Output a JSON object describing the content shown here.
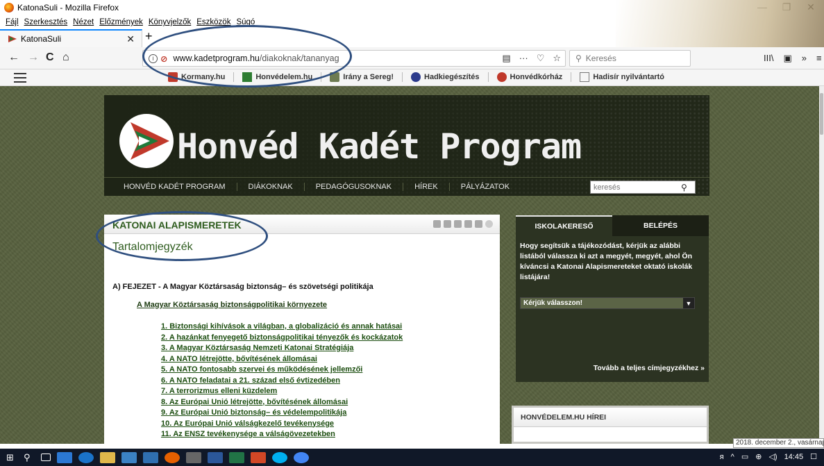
{
  "window": {
    "title": "KatonaSuli - Mozilla Firefox",
    "minimize": "—",
    "maximize": "❐",
    "close": "✕"
  },
  "menu": [
    "Fájl",
    "Szerkesztés",
    "Nézet",
    "Előzmények",
    "Könyvjelzők",
    "Eszközök",
    "Súgó"
  ],
  "tab": {
    "label": "KatonaSuli",
    "close": "✕",
    "new": "+"
  },
  "nav": {
    "back": "←",
    "forward": "→",
    "reload": "C",
    "home": "⌂",
    "url_host": "www.kadetprogram.hu",
    "url_path": "/diakoknak/tananyag",
    "search_placeholder": "Keresés",
    "more": "···",
    "pocket": "♡",
    "star": "☆",
    "library": "III\\",
    "sidebar": "▣",
    "overflow": "»",
    "menu": "≡"
  },
  "govbar": [
    {
      "label": "Kormany.hu",
      "color": "#c0392b"
    },
    {
      "label": "Honvédelem.hu",
      "color": "#2e7d32"
    },
    {
      "label": "Irány a Sereg!",
      "color": "#6d7b52"
    },
    {
      "label": "Hadkiegészítés",
      "color": "#2b3a8c"
    },
    {
      "label": "Honvédkórház",
      "color": "#c0392b"
    },
    {
      "label": "Hadisír nyilvántartó",
      "color": "#777777"
    }
  ],
  "banner": {
    "title": "Honvéd Kadét Program"
  },
  "mainnav": [
    "HONVÉD KADÉT PROGRAM",
    "DIÁKOKNAK",
    "PEDAGÓGUSOKNAK",
    "HÍREK",
    "PÁLYÁZATOK"
  ],
  "site_search_placeholder": "keresés",
  "content": {
    "title": "KATONAI ALAPISMERETEK",
    "toc": "Tartalomjegyzék",
    "chapter": "A) FEJEZET  -  A Magyar Köztársaság biztonság– és szövetségi politikája",
    "section": "A Magyar Köztársaság biztonságpolitikai környezete",
    "items": [
      "1. Biztonsági kihívások a világban, a globalizáció és annak hatásai",
      "2. A hazánkat fenyegető biztonságpolitikai tényezők és kockázatok",
      "3. A Magyar Köztársaság Nemzeti Katonai Stratégiája",
      "4. A NATO létrejötte, bővítésének állomásai",
      "5. A NATO fontosabb szervei és működésének jellemzői",
      "6. A NATO feladatai a 21. század első évtizedében",
      "7. A terrorizmus elleni küzdelem",
      "8. Az Európai Unió létrejötte, bővítésének állomásai",
      "9. Az Európai Unió biztonság– és védelempolitikája",
      "10. Az Európai Unió válságkezelő tevékenysége",
      "11. Az ENSZ tevékenysége a válságövezetekben"
    ]
  },
  "sidebar": {
    "tab1": "ISKOLAKERESŐ",
    "tab2": "BELÉPÉS",
    "text": "Hogy segítsük a tájékozódást, kérjük az alábbi listából válassza ki azt a megyét, megyét, ahol Ön kíváncsi a Katonai Alapismereteket oktató iskolák listájára!",
    "select": "Kérjük válasszon!",
    "more": "Tovább a teljes címjegyzékhez »"
  },
  "news": {
    "title": "HONVÉDELEM.HU HÍREI"
  },
  "tooltip": "2018. december 2., vasárnap",
  "tray": {
    "time": "14:45"
  }
}
